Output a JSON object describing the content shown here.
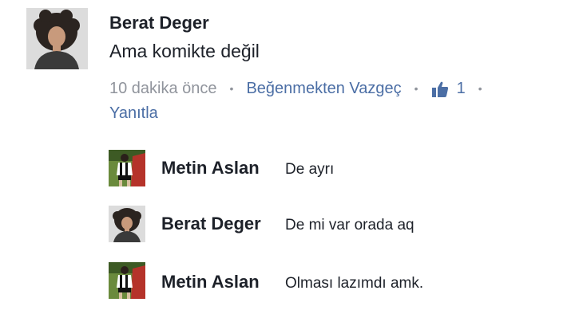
{
  "main_comment": {
    "author": "Berat Deger",
    "text": "Ama komikte değil",
    "time": "10 dakika önce",
    "dot": "•",
    "unlike_label": "Beğenmekten Vazgeç",
    "like_count": "1",
    "reply_label": "Yanıtla",
    "avatar_icon": "curly-hair-avatar-icon",
    "like_icon": "thumbs-up-icon"
  },
  "replies": [
    {
      "author": "Metin Aslan",
      "text": "De ayrı",
      "avatar_icon": "soccer-player-avatar-icon"
    },
    {
      "author": "Berat Deger",
      "text": "De mi var orada aq",
      "avatar_icon": "curly-hair-avatar-icon"
    },
    {
      "author": "Metin Aslan",
      "text": "Olması lazımdı amk.",
      "avatar_icon": "soccer-player-avatar-icon"
    }
  ],
  "colors": {
    "link": "#4b6ea5",
    "meta_gray": "#90949c",
    "text": "#1d2129"
  }
}
